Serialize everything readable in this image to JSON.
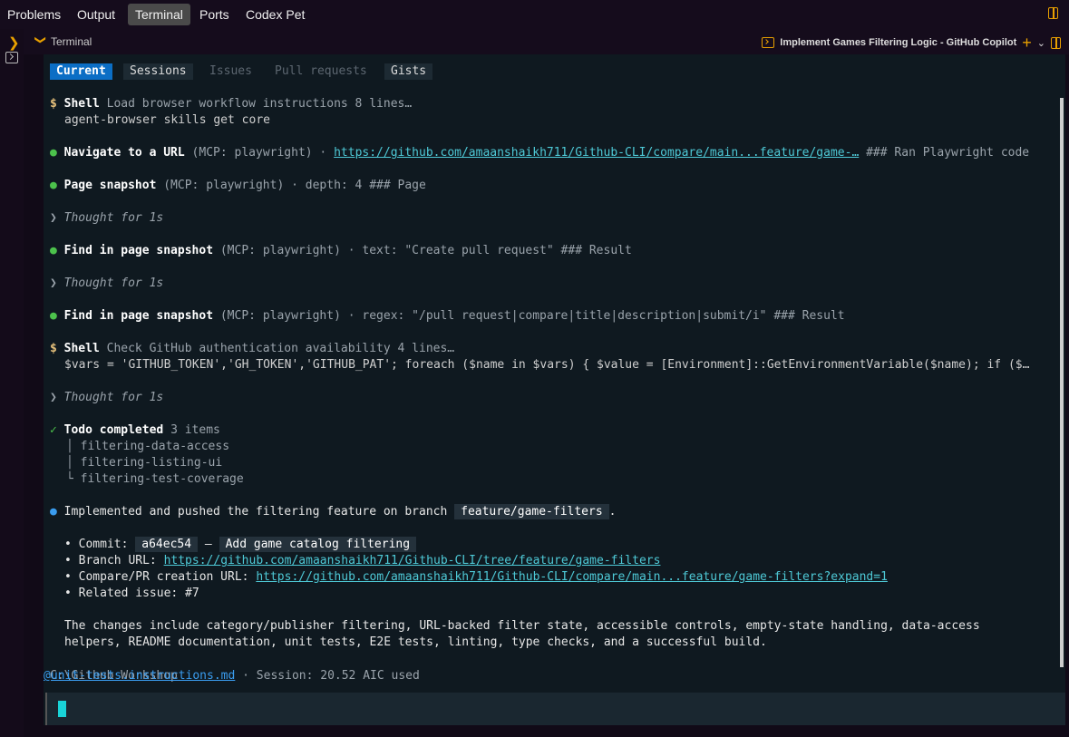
{
  "panel_tabs": [
    "Problems",
    "Output",
    "Terminal",
    "Ports",
    "Codex Pet"
  ],
  "terminal_header": {
    "label": "Terminal",
    "session_title": "Implement Games Filtering Logic - GitHub Copilot"
  },
  "sub_tabs": [
    "Current",
    "Sessions",
    "Issues",
    "Pull requests",
    "Gists"
  ],
  "log": {
    "shell1": {
      "title": "Shell",
      "desc": "Load browser workflow instructions 8 lines…",
      "cmd": "agent-browser skills get core"
    },
    "nav": {
      "title": "Navigate to a URL",
      "meta": "(MCP: playwright) · ",
      "url": "https://github.com/amaanshaikh711/Github-CLI/compare/main...feature/game-…",
      "tail": " ### Ran Playwright code"
    },
    "snap1": {
      "title": "Page snapshot",
      "meta": "(MCP: playwright) · depth: 4 ### Page"
    },
    "thought": "Thought for 1s",
    "find1": {
      "title": "Find in page snapshot",
      "meta": "(MCP: playwright) · text: \"Create pull request\" ### Result"
    },
    "find2": {
      "title": "Find in page snapshot",
      "meta": "(MCP: playwright) · regex: \"/pull request|compare|title|description|submit/i\" ### Result"
    },
    "shell2": {
      "title": "Shell",
      "desc": "Check GitHub authentication availability 4 lines…",
      "cmd": "$vars = 'GITHUB_TOKEN','GH_TOKEN','GITHUB_PAT'; foreach ($name in $vars) { $value = [Environment]::GetEnvironmentVariable($name); if ($…"
    },
    "todo": {
      "title": "Todo completed",
      "count": "3 items",
      "items": [
        "filtering-data-access",
        "filtering-listing-ui",
        "filtering-test-coverage"
      ]
    },
    "summary": {
      "text": "Implemented and pushed the filtering feature on branch ",
      "branch": "feature/game-filters",
      "end": "."
    },
    "bullets": {
      "commit_label": "• Commit: ",
      "commit_hash": "a64ec54",
      "commit_sep": " — ",
      "commit_msg": "Add game catalog filtering",
      "branch_label": "• Branch URL: ",
      "branch_url": "https://github.com/amaanshaikh711/Github-CLI/tree/feature/game-filters",
      "compare_label": "• Compare/PR creation URL: ",
      "compare_url": "https://github.com/amaanshaikh711/Github-CLI/compare/main...feature/game-filters?expand=1",
      "issue": "• Related issue: #7"
    },
    "para1": "The changes include category/publisher filtering, URL-backed filter state, accessible controls, empty-state handling, data-access",
    "para2": "helpers, README documentation, unit tests, E2E tests, linting, type checks, and a successful build."
  },
  "status": {
    "cwd": "C:\\Github Workshop",
    "instructions": "@unit-tests.instructions.md",
    "session": " · Session: 20.52 AIC used"
  },
  "colors": {
    "accent": "#e8a000",
    "current_tab": "#0b6ec5",
    "link": "#4ec9d6",
    "cursor": "#19d3d7"
  }
}
